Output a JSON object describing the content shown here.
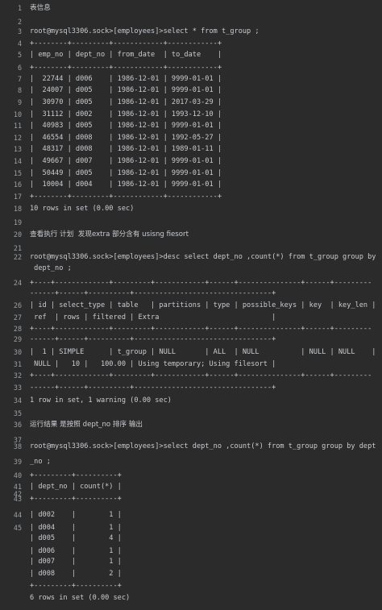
{
  "editor": {
    "lines": [
      {
        "ln": "1",
        "text": "表信息"
      },
      {
        "ln": "2",
        "text": ""
      },
      {
        "ln": "3",
        "text": "root@mysql3306.sock>[employees]>select * from t_group ;"
      },
      {
        "ln": "4",
        "text": "+--------+---------+------------+------------+"
      },
      {
        "ln": "5",
        "text": "| emp_no | dept_no | from_date  | to_date    |"
      },
      {
        "ln": "6",
        "text": "+--------+---------+------------+------------+"
      },
      {
        "ln": "7",
        "text": "|  22744 | d006    | 1986-12-01 | 9999-01-01 |"
      },
      {
        "ln": "8",
        "text": "|  24007 | d005    | 1986-12-01 | 9999-01-01 |"
      },
      {
        "ln": "9",
        "text": "|  30970 | d005    | 1986-12-01 | 2017-03-29 |"
      },
      {
        "ln": "10",
        "text": "|  31112 | d002    | 1986-12-01 | 1993-12-10 |"
      },
      {
        "ln": "11",
        "text": "|  40983 | d005    | 1986-12-01 | 9999-01-01 |"
      },
      {
        "ln": "12",
        "text": "|  46554 | d008    | 1986-12-01 | 1992-05-27 |"
      },
      {
        "ln": "13",
        "text": "|  48317 | d008    | 1986-12-01 | 1989-01-11 |"
      },
      {
        "ln": "14",
        "text": "|  49667 | d007    | 1986-12-01 | 9999-01-01 |"
      },
      {
        "ln": "15",
        "text": "|  50449 | d005    | 1986-12-01 | 9999-01-01 |"
      },
      {
        "ln": "16",
        "text": "|  10004 | d004    | 1986-12-01 | 9999-01-01 |"
      },
      {
        "ln": "17",
        "text": "+--------+---------+------------+------------+"
      },
      {
        "ln": "18",
        "text": "10 rows in set (0.00 sec)"
      },
      {
        "ln": "19",
        "text": ""
      },
      {
        "ln": "20",
        "text": "查看执行 计划  发现extra 部分含有 usisng fiesort"
      },
      {
        "ln": "21",
        "text": ""
      },
      {
        "ln": "22",
        "text": "root@mysql3306.sock>[employees]>desc select dept_no ,count(*) from t_group group by"
      },
      {
        "ln": "",
        "text": " dept_no ;"
      },
      {
        "ln": "24",
        "text": "+----+-------------+---------+------------+------+---------------+------+---------"
      },
      {
        "ln": "",
        "text": "------+------+----------+---------------------------------+"
      },
      {
        "ln": "26",
        "text": "| id | select_type | table   | partitions | type | possible_keys | key  | key_len |"
      },
      {
        "ln": "27",
        "text": " ref  | rows | filtered | Extra                           |"
      },
      {
        "ln": "28",
        "text": "+----+-------------+---------+------------+------+---------------+------+---------"
      },
      {
        "ln": "29",
        "text": "------+------+----------+---------------------------------+"
      },
      {
        "ln": "30",
        "text": "|  1 | SIMPLE      | t_group | NULL       | ALL  | NULL          | NULL | NULL    |"
      },
      {
        "ln": "31",
        "text": " NULL |   10 |   100.00 | Using temporary; Using filesort |"
      },
      {
        "ln": "32",
        "text": "+----+-------------+---------+------------+------+---------------+------+---------"
      },
      {
        "ln": "33",
        "text": "------+------+----------+---------------------------------+"
      },
      {
        "ln": "34",
        "text": "1 row in set, 1 warning (0.00 sec)"
      },
      {
        "ln": "35",
        "text": ""
      },
      {
        "ln": "36",
        "text": "运行结果 是按照 dept_no 排序 输出"
      },
      {
        "ln": "37",
        "text": ""
      },
      {
        "ln": "38",
        "text": "root@mysql3306.sock>[employees]>select dept_no ,count(*) from t_group group by dept"
      },
      {
        "ln": "39",
        "text": "_no ;"
      },
      {
        "ln": "40",
        "text": "+---------+----------+"
      },
      {
        "ln": "41",
        "text": "| dept_no | count(*) |"
      },
      {
        "ln": "42",
        "text": ""
      },
      {
        "ln": "43",
        "text": "+---------+----------+"
      },
      {
        "ln": "44",
        "text": "| d002    |        1 |"
      },
      {
        "ln": "45",
        "text": "| d004    |        1 |"
      },
      {
        "ln": "",
        "text": "| d005    |        4 |"
      },
      {
        "ln": "",
        "text": "| d006    |        1 |"
      },
      {
        "ln": "",
        "text": "| d007    |        1 |"
      },
      {
        "ln": "",
        "text": "| d008    |        2 |"
      },
      {
        "ln": "",
        "text": "+---------+----------+"
      },
      {
        "ln": "",
        "text": "6 rows in set (0.00 sec)"
      }
    ]
  }
}
